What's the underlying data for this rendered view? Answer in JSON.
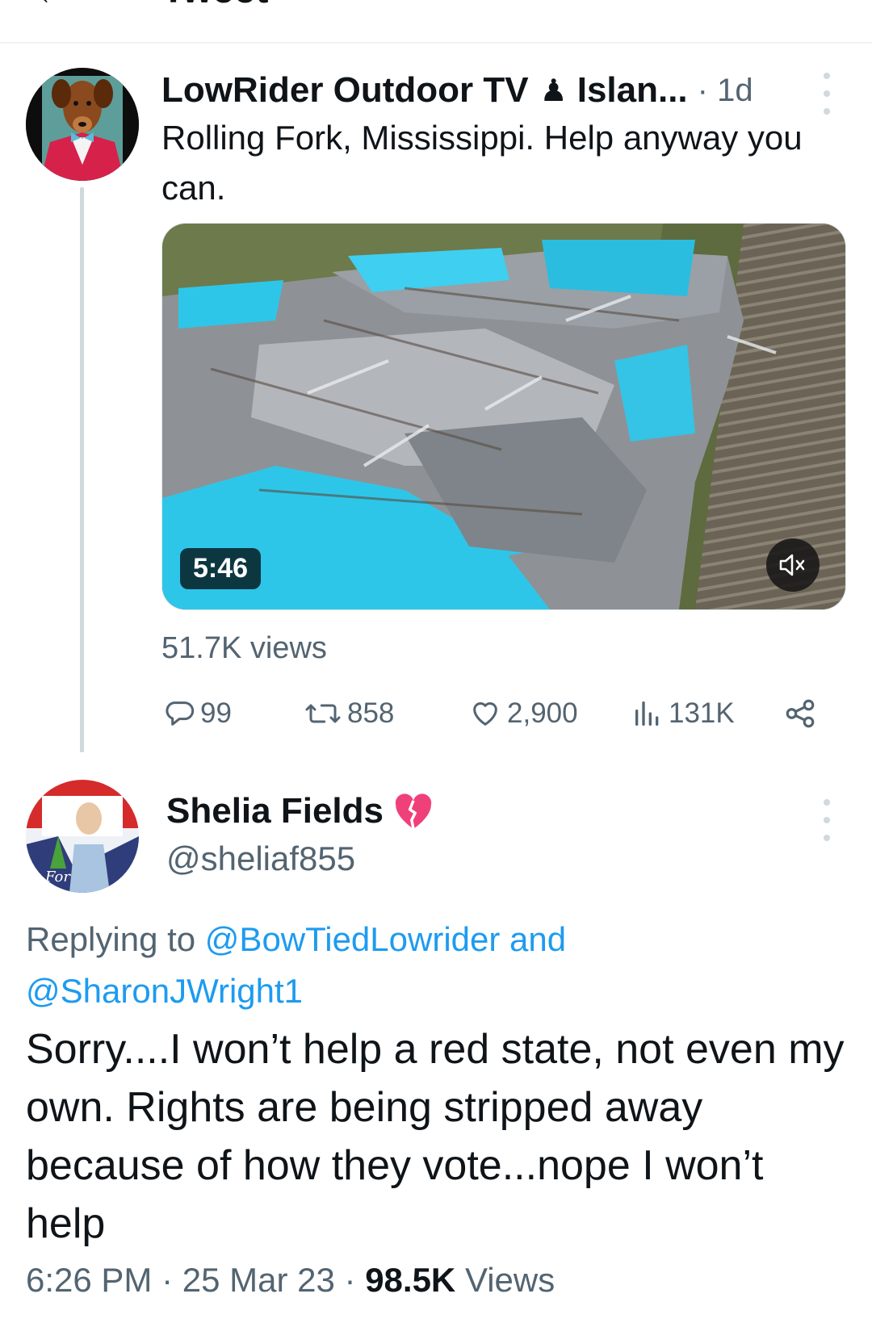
{
  "header": {
    "title": "Tweet"
  },
  "tweet": {
    "author_name": "LowRider Outdoor TV",
    "author_badge": "♟",
    "author_name_rest": "Islan...",
    "time": "· 1d",
    "text": "Rolling Fork, Mississippi. Help anyway you can.",
    "video": {
      "duration": "5:46",
      "muted_icon": "volume-mute-icon"
    },
    "views": "51.7K views",
    "actions": {
      "replies": "99",
      "retweets": "858",
      "likes": "2,900",
      "analytics": "131K"
    }
  },
  "reply": {
    "author_name": "Shelia Fields",
    "author_emoji": "broken-heart-icon",
    "handle": "@sheliaf855",
    "replying_prefix": "Replying to",
    "replying_users": "@BowTiedLowrider and @SharonJWright1",
    "text": "Sorry....I won’t help a red state, not even my own. Rights are being stripped away because of how they vote...nope I won’t help",
    "time": "6:26 PM",
    "date": "25 Mar 23",
    "views_count": "98.5K",
    "views_label": "Views"
  },
  "colors": {
    "link": "#1d9bf0",
    "muted": "#536471",
    "text": "#0f1419",
    "video_blue": "#2ec6e8"
  }
}
